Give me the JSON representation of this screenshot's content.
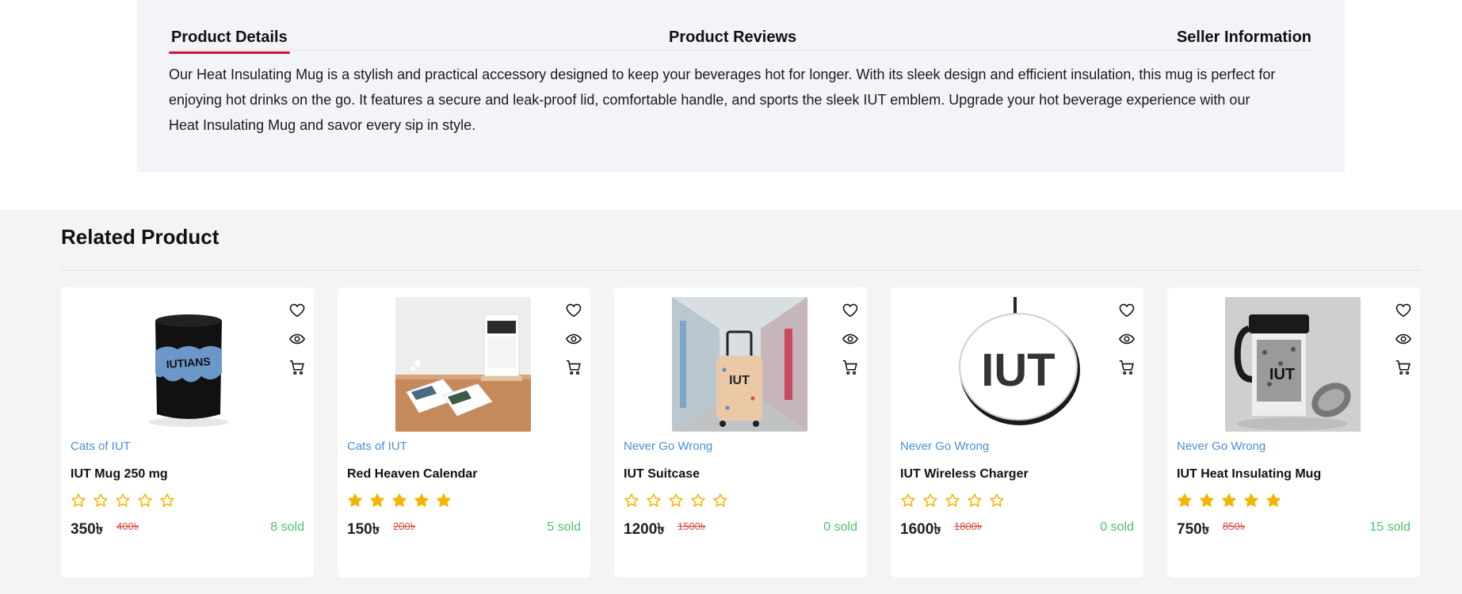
{
  "tabs": {
    "details": "Product Details",
    "reviews": "Product Reviews",
    "seller": "Seller Information"
  },
  "description": "Our Heat Insulating Mug is a stylish and practical accessory designed to keep your beverages hot for longer. With its sleek design and efficient insulation, this mug is perfect for enjoying hot drinks on the go. It features a secure and leak-proof lid, comfortable handle, and sports the sleek IUT emblem. Upgrade your hot beverage experience with our Heat Insulating Mug and savor every sip in style.",
  "related": {
    "title": "Related Product",
    "products": [
      {
        "category": "Cats of IUT",
        "name": "IUT Mug 250 mg",
        "price": "350৳",
        "old_price": "400৳",
        "sold": "8 sold",
        "rating": 0,
        "image": "black-mug-iutians-image"
      },
      {
        "category": "Cats of IUT",
        "name": "Red Heaven Calendar",
        "price": "150৳",
        "old_price": "200৳",
        "sold": "5 sold",
        "rating": 5,
        "image": "desk-calendar-image"
      },
      {
        "category": "Never Go Wrong",
        "name": "IUT Suitcase",
        "price": "1200৳",
        "old_price": "1500৳",
        "sold": "0 sold",
        "rating": 0,
        "image": "suitcase-image"
      },
      {
        "category": "Never Go Wrong",
        "name": "IUT Wireless Charger",
        "price": "1600৳",
        "old_price": "1800৳",
        "sold": "0 sold",
        "rating": 0,
        "image": "wireless-charger-image"
      },
      {
        "category": "Never Go Wrong",
        "name": "IUT Heat Insulating Mug",
        "price": "750৳",
        "old_price": "850৳",
        "sold": "15 sold",
        "rating": 5,
        "image": "travel-mug-image"
      }
    ]
  },
  "icons": [
    "heart-icon",
    "eye-icon",
    "cart-icon",
    "star-icon"
  ],
  "colors": {
    "tab_underline": "#d0103a",
    "category": "#4b8fd9",
    "old_price": "#d9473b",
    "sold": "#4cc36b",
    "star": "#f5b400"
  }
}
